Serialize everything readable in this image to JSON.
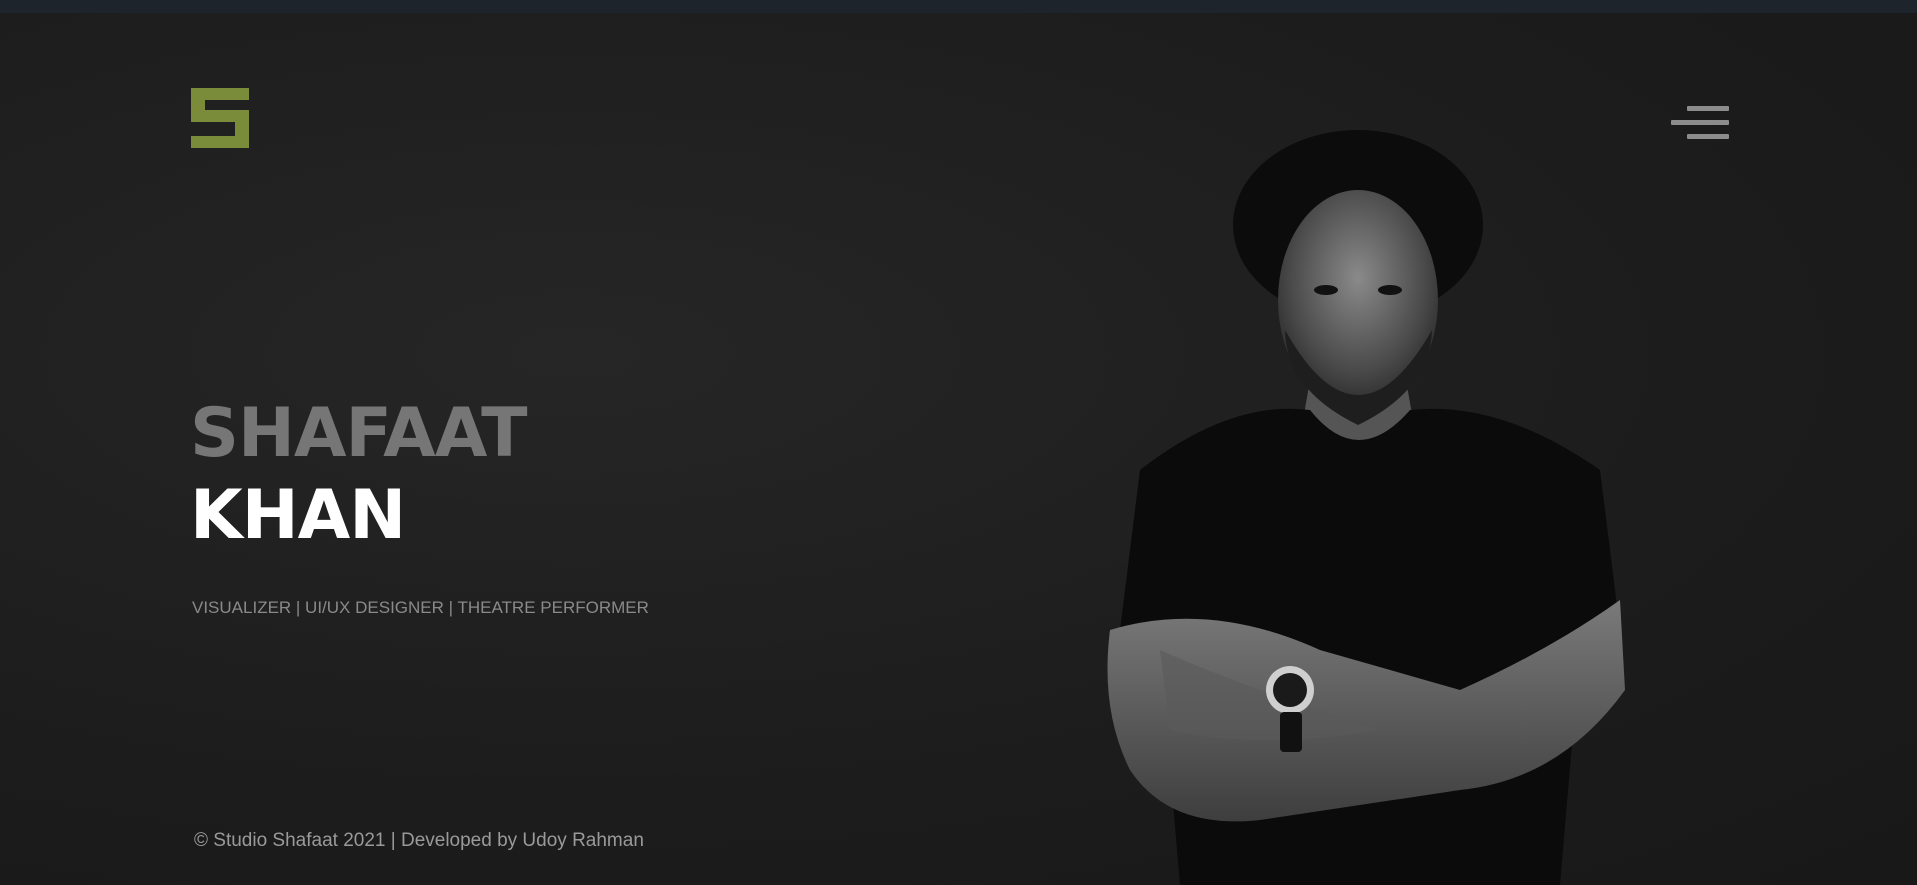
{
  "header": {
    "logo_icon": "s-monogram-logo",
    "menu_icon": "hamburger-menu-icon"
  },
  "hero": {
    "first_name": "SHAFAAT",
    "last_name": "KHAN",
    "tagline": "VISUALIZER | UI/UX DESIGNER | THEATRE PERFORMER",
    "portrait": "portrait-photo"
  },
  "footer": {
    "copyright": "© Studio Shafaat 2021 | Developed by Udoy Rahman"
  },
  "colors": {
    "accent": "#7a8c3a",
    "background": "#1c1c1c",
    "topbar": "#1e242b",
    "first_name": "#767676",
    "last_name": "#ffffff",
    "muted_text": "#8a8a8a"
  }
}
